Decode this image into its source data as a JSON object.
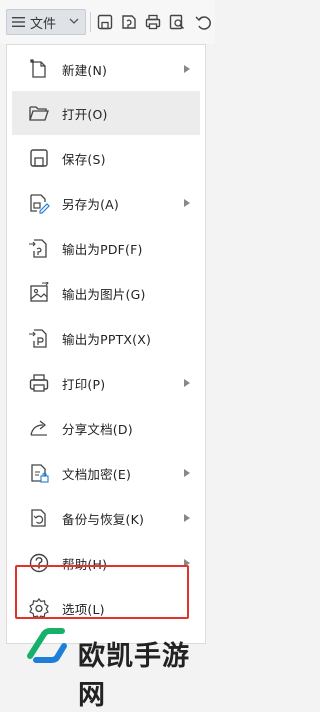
{
  "toolbar": {
    "file_menu_label": "文件",
    "icons": [
      "hamburger-icon",
      "chevron-down-icon",
      "save-icon",
      "save-as-icon",
      "print-icon",
      "print-preview-icon",
      "undo-icon"
    ]
  },
  "menu": {
    "items": [
      {
        "label": "新建(N)",
        "icon": "new-document-icon",
        "submenu": true
      },
      {
        "label": "打开(O)",
        "icon": "folder-open-icon",
        "submenu": false
      },
      {
        "label": "保存(S)",
        "icon": "save-icon",
        "submenu": false
      },
      {
        "label": "另存为(A)",
        "icon": "save-as-icon",
        "submenu": true
      },
      {
        "label": "输出为PDF(F)",
        "icon": "export-pdf-icon",
        "submenu": false
      },
      {
        "label": "输出为图片(G)",
        "icon": "export-image-icon",
        "submenu": false
      },
      {
        "label": "输出为PPTX(X)",
        "icon": "export-pptx-icon",
        "submenu": false
      },
      {
        "label": "打印(P)",
        "icon": "print-icon",
        "submenu": true
      },
      {
        "label": "分享文档(D)",
        "icon": "share-icon",
        "submenu": false
      },
      {
        "label": "文档加密(E)",
        "icon": "encrypt-document-icon",
        "submenu": true
      },
      {
        "label": "备份与恢复(K)",
        "icon": "backup-restore-icon",
        "submenu": true
      },
      {
        "label": "帮助(H)",
        "icon": "help-icon",
        "submenu": true
      },
      {
        "label": "选项(L)",
        "icon": "gear-icon",
        "submenu": false
      }
    ]
  },
  "watermark": {
    "text": "欧凯手游网"
  },
  "colors": {
    "highlight_border": "#e5312b",
    "hover_bg": "#ececec",
    "logo_green": "#17b06b",
    "logo_blue": "#1e7fd8"
  }
}
